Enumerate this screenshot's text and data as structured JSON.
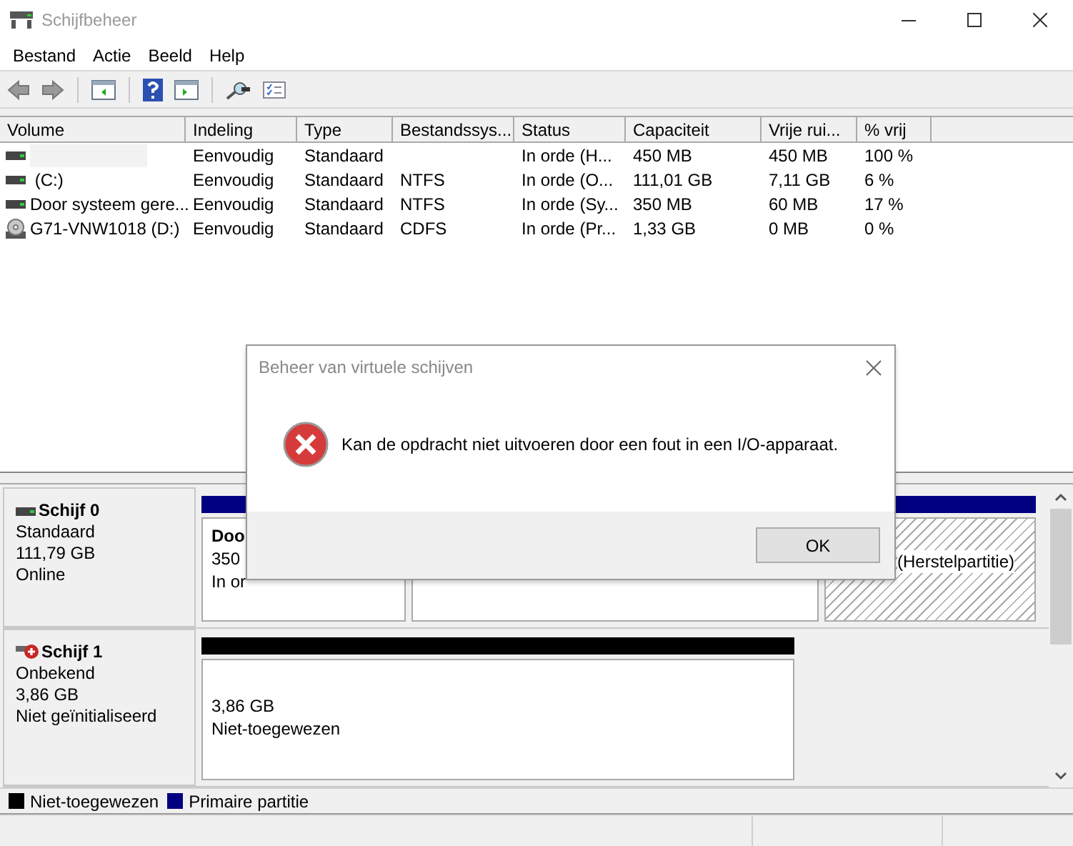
{
  "window": {
    "title": "Schijfbeheer"
  },
  "menu": [
    "Bestand",
    "Actie",
    "Beeld",
    "Help"
  ],
  "table": {
    "columns": [
      "Volume",
      "Indeling",
      "Type",
      "Bestandssys...",
      "Status",
      "Capaciteit",
      "Vrije rui...",
      "% vrij"
    ],
    "rows": [
      {
        "kind": "disk",
        "cells": [
          "",
          "Eenvoudig",
          "Standaard",
          "",
          "In orde (H...",
          "450 MB",
          "450 MB",
          "100 %"
        ]
      },
      {
        "kind": "disk",
        "cells": [
          " (C:)",
          "Eenvoudig",
          "Standaard",
          "NTFS",
          "In orde (O...",
          "111,01 GB",
          "7,11 GB",
          "6 %"
        ]
      },
      {
        "kind": "disk",
        "cells": [
          "Door systeem gere...",
          "Eenvoudig",
          "Standaard",
          "NTFS",
          "In orde (Sy...",
          "350 MB",
          "60 MB",
          "17 %"
        ]
      },
      {
        "kind": "cd",
        "cells": [
          "G71-VNW1018 (D:)",
          "Eenvoudig",
          "Standaard",
          "CDFS",
          "In orde (Pr...",
          "1,33 GB",
          "0 MB",
          "0 %"
        ]
      }
    ]
  },
  "disks": [
    {
      "name": "Schijf 0",
      "error": false,
      "lines": [
        "Standaard",
        "111,79 GB",
        "Online"
      ],
      "partitions": [
        {
          "color": "#000080",
          "hatched": false,
          "title": "Doo",
          "lines": [
            "350",
            "In or"
          ]
        },
        {
          "hatched": false
        },
        {
          "color": "#000080",
          "hatched": true,
          "lines": [
            "(Herstelpartitie)"
          ]
        }
      ]
    },
    {
      "name": "Schijf 1",
      "error": true,
      "lines": [
        "Onbekend",
        "3,86 GB",
        "Niet geïnitialiseerd"
      ],
      "partitions": [
        {
          "color": "#000000",
          "hatched": false,
          "lines": [
            "3,86 GB",
            "Niet-toegewezen"
          ]
        }
      ]
    }
  ],
  "legend": [
    {
      "label": "Niet-toegewezen",
      "color": "#000000"
    },
    {
      "label": "Primaire partitie",
      "color": "#000080"
    }
  ],
  "dialog": {
    "title": "Beheer van virtuele schijven",
    "message": "Kan de opdracht niet uitvoeren door een fout in een I/O-apparaat.",
    "button": "OK"
  }
}
